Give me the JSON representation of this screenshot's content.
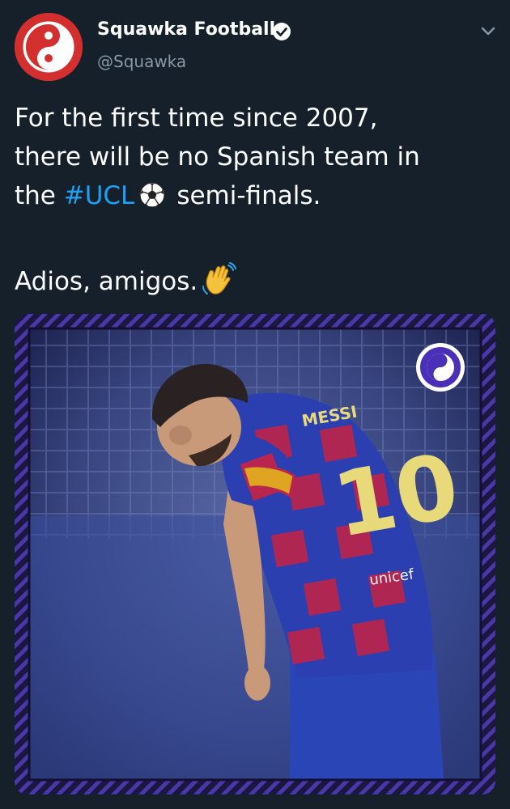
{
  "tweet": {
    "display_name": "Squawka Football",
    "handle": "@Squawka",
    "verified_icon": "verified-badge-icon",
    "menu_icon": "chevron-down-icon",
    "text": {
      "line1": "For the first time since 2007,",
      "line2": "there will be no Spanish team in",
      "line3_prefix": "the ",
      "hashtag": "#UCL",
      "line3_suffix": "semi-finals.",
      "line4": "Adios, amigos."
    },
    "emojis": [
      "soccer-ball-icon",
      "waving-hand-icon"
    ],
    "media": {
      "shirt_number": "10",
      "shirt_name": "MESSI",
      "sponsor": "unicef",
      "logo_icon": "squawka-logo-icon"
    }
  },
  "colors": {
    "background": "#15202b",
    "text": "#ffffff",
    "secondary_text": "#8899a6",
    "link": "#1da1f2",
    "avatar_red": "#d32f2f",
    "frame_purple": "#3b2a8a"
  }
}
